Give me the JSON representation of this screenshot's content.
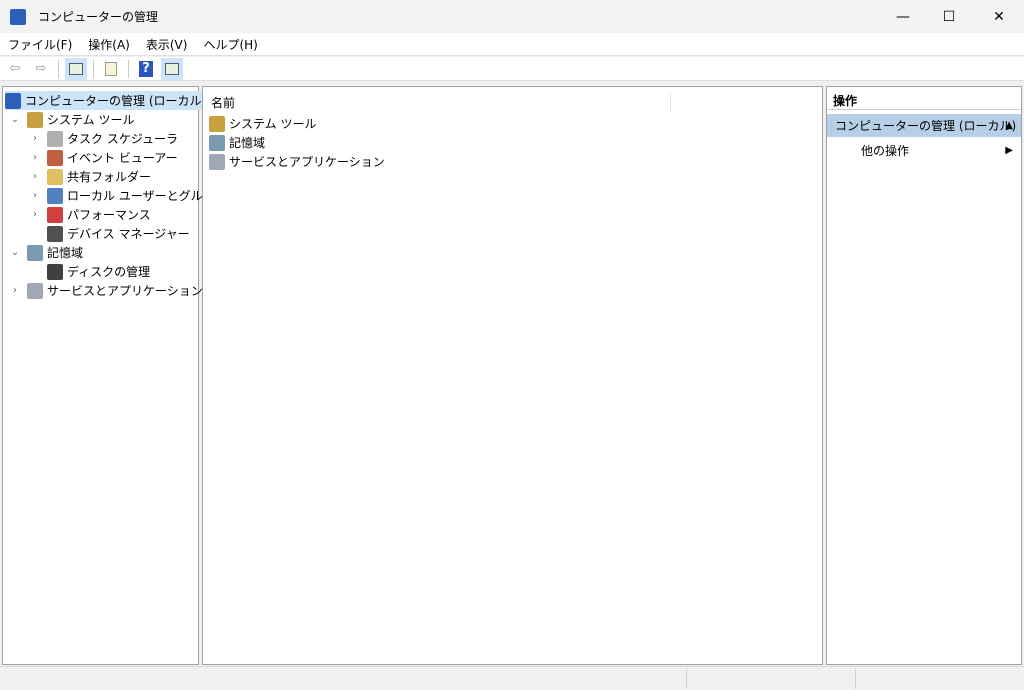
{
  "window": {
    "title": "コンピューターの管理",
    "minimize": "—",
    "maximize": "☐",
    "close": "✕"
  },
  "menu": [
    "ファイル(F)",
    "操作(A)",
    "表示(V)",
    "ヘルプ(H)"
  ],
  "toolbar": {
    "back": "⇦",
    "forward": "⇨",
    "help": "?"
  },
  "tree": [
    {
      "label": "コンピューターの管理 (ローカル)",
      "level": 0,
      "chev": "",
      "icon": "computer-management-icon",
      "selected": true
    },
    {
      "label": "システム ツール",
      "level": 1,
      "chev": "⌄",
      "icon": "tools-icon"
    },
    {
      "label": "タスク スケジューラ",
      "level": 2,
      "chev": "›",
      "icon": "clock-icon"
    },
    {
      "label": "イベント ビューアー",
      "level": 2,
      "chev": "›",
      "icon": "event-viewer-icon"
    },
    {
      "label": "共有フォルダー",
      "level": 2,
      "chev": "›",
      "icon": "shared-folder-icon"
    },
    {
      "label": "ローカル ユーザーとグループ",
      "level": 2,
      "chev": "›",
      "icon": "users-icon"
    },
    {
      "label": "パフォーマンス",
      "level": 2,
      "chev": "›",
      "icon": "performance-icon"
    },
    {
      "label": "デバイス マネージャー",
      "level": 2,
      "chev": "",
      "icon": "device-manager-icon"
    },
    {
      "label": "記憶域",
      "level": 1,
      "chev": "⌄",
      "icon": "storage-icon"
    },
    {
      "label": "ディスクの管理",
      "level": 2,
      "chev": "",
      "icon": "disk-icon"
    },
    {
      "label": "サービスとアプリケーション",
      "level": 1,
      "chev": "›",
      "icon": "services-icon"
    }
  ],
  "list": {
    "header": "名前",
    "items": [
      "システム ツール",
      "記憶域",
      "サービスとアプリケーション"
    ]
  },
  "actions": {
    "header": "操作",
    "section": "コンピューターの管理 (ローカル)",
    "collapse": "▲",
    "item": "他の操作",
    "arrow": "▶"
  }
}
